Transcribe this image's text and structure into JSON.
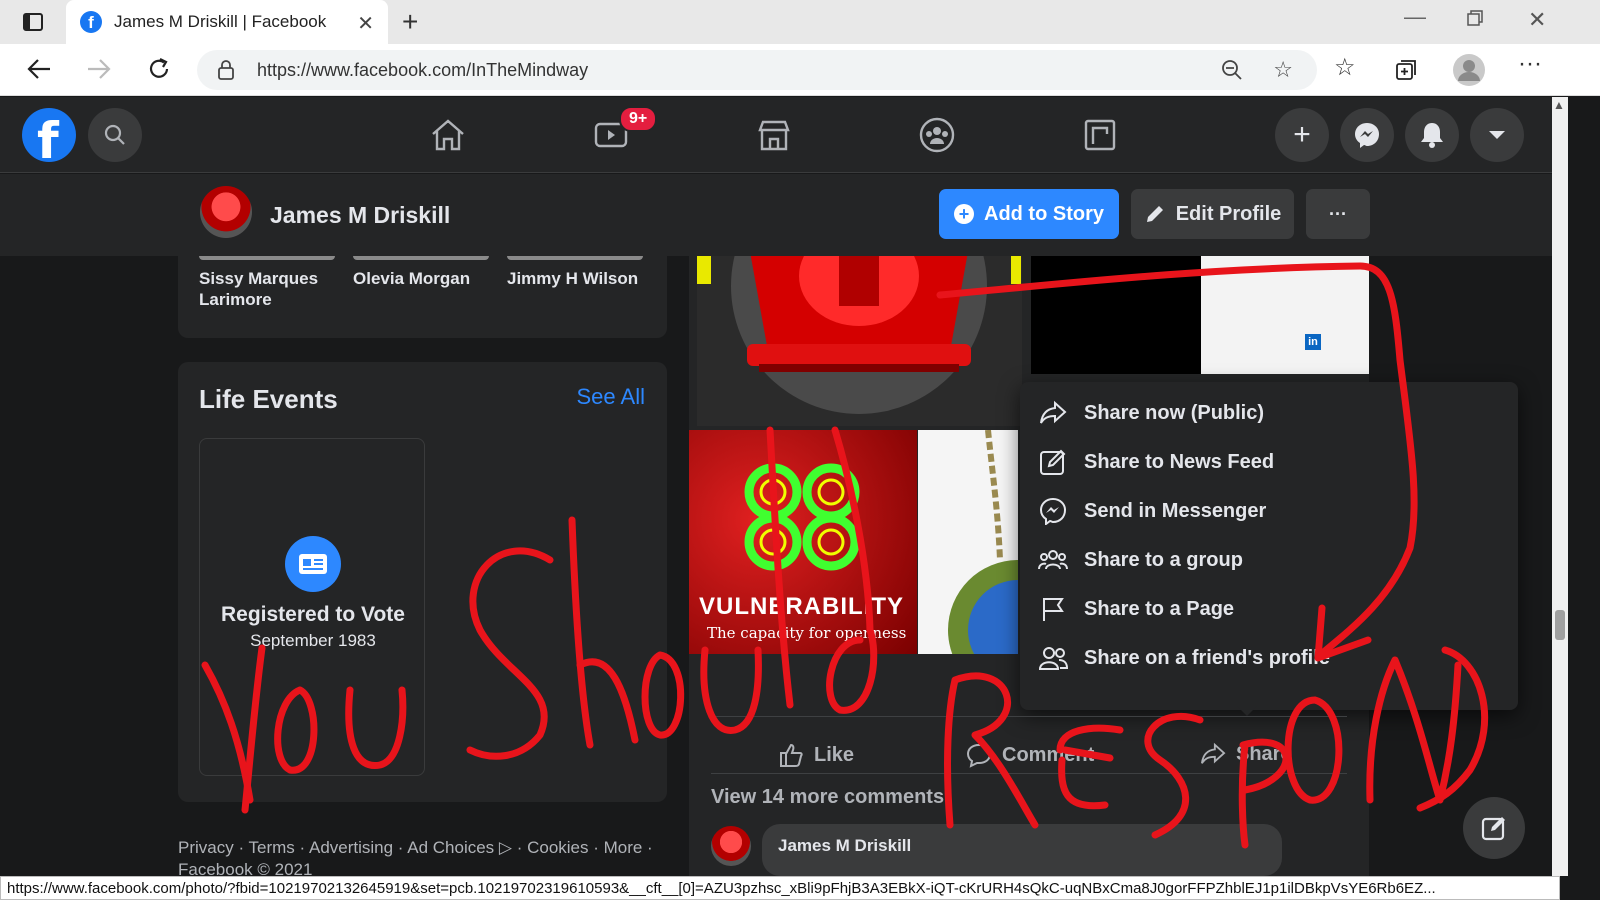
{
  "browser": {
    "tab_title": "James M Driskill | Facebook",
    "new_tab": "+",
    "url": "https://www.facebook.com/InTheMindway",
    "status_url": "https://www.facebook.com/photo/?fbid=10219702132645919&set=pcb.10219702319610593&__cft__[0]=AZU3pzhsc_xBli9pFhjB3A3EBkX-iQT-cKrURH4sQkC-uqNBxCma8J0gorFFPZhblEJ1p1ilDBkpVsYE6Rb6EZ..."
  },
  "fbnav": {
    "video_badge": "9+"
  },
  "profile_header": {
    "name": "James M Driskill",
    "add_to_story": "Add to Story",
    "edit_profile": "Edit Profile",
    "more": "···"
  },
  "friends": [
    {
      "name": "Sissy Marques Larimore"
    },
    {
      "name": "Olevia Morgan"
    },
    {
      "name": "Jimmy H Wilson"
    }
  ],
  "life_events": {
    "title": "Life Events",
    "see_all": "See All",
    "event_title": "Registered to Vote",
    "event_date": "September 1983"
  },
  "post": {
    "photo_text_1": "VULNERABILITY",
    "photo_text_2": "The capacity for openness",
    "like": "Like",
    "comment": "Comment",
    "share": "Share",
    "view_more_comments": "View 14 more comments",
    "commenter": "James M Driskill"
  },
  "share_menu": {
    "items": [
      {
        "label": "Share now (Public)",
        "icon": "share-arrow-icon"
      },
      {
        "label": "Share to News Feed",
        "icon": "edit-icon"
      },
      {
        "label": "Send in Messenger",
        "icon": "messenger-icon"
      },
      {
        "label": "Share to a group",
        "icon": "group-icon"
      },
      {
        "label": "Share to a Page",
        "icon": "flag-icon"
      },
      {
        "label": "Share on a friend's profile",
        "icon": "friends-icon"
      }
    ]
  },
  "footer": {
    "line1": "Privacy · Terms · Advertising · Ad Choices ▷ · Cookies · More ·",
    "line2": "Facebook © 2021"
  },
  "annotation": {
    "text_1": "You Should",
    "text_2": "RESPOND"
  },
  "colors": {
    "fb_blue": "#1877f2",
    "dark_bg": "#18191a",
    "surface": "#242526",
    "annotation_red": "#e8141b"
  }
}
